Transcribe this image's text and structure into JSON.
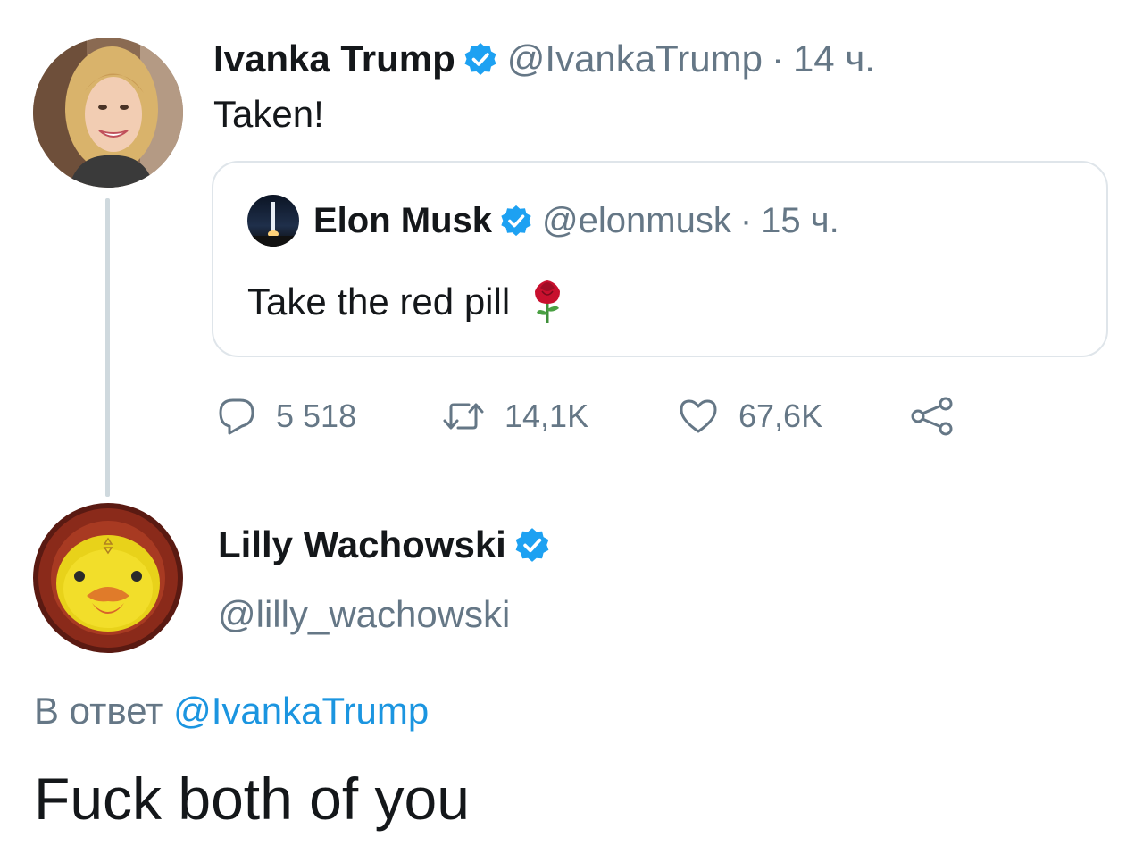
{
  "tweet": {
    "author": {
      "display_name": "Ivanka Trump",
      "handle": "@IvankaTrump",
      "verified": true,
      "avatar_icon": "portrait-photo"
    },
    "separator": "·",
    "time": "14 ч.",
    "text": "Taken!",
    "quoted": {
      "author": {
        "display_name": "Elon Musk",
        "handle": "@elonmusk",
        "verified": true,
        "avatar_icon": "rocket-launch-photo"
      },
      "separator": "·",
      "time": "15 ч.",
      "text": "Take the red pill",
      "emoji": "rose-emoji"
    },
    "actions": {
      "replies": "5 518",
      "retweets": "14,1K",
      "likes": "67,6K"
    }
  },
  "reply": {
    "author": {
      "display_name": "Lilly Wachowski",
      "handle": "@lilly_wachowski",
      "verified": true,
      "avatar_icon": "duck-painting"
    },
    "context_prefix": "В ответ",
    "context_mention": "@IvankaTrump",
    "text": "Fuck both of you"
  },
  "colors": {
    "verified_blue": "#1da1f2",
    "link_blue": "#1b95e0",
    "secondary_text": "#657786",
    "primary_text": "#14171a",
    "thread_line": "#cfd9de"
  }
}
